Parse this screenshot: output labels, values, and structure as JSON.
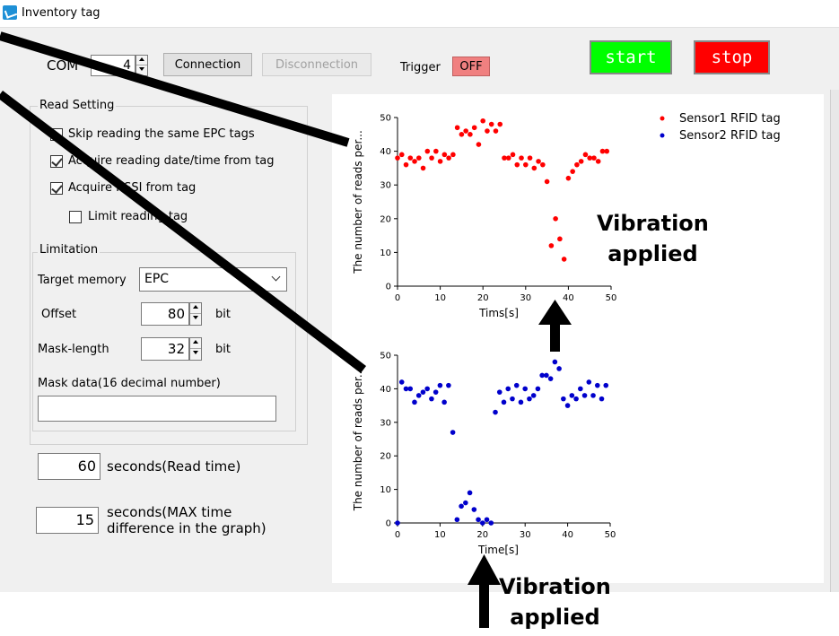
{
  "window": {
    "title": "Inventory tag"
  },
  "toolbar": {
    "com_label": "COM",
    "com_value": "4",
    "connection_label": "Connection",
    "disconnection_label": "Disconnection",
    "trigger_label": "Trigger",
    "trigger_state": "OFF",
    "start_label": "start",
    "stop_label": "stop"
  },
  "read_setting": {
    "title": "Read Setting",
    "skip_same_epc": "Skip reading the same EPC tags",
    "acquire_datetime": "Acquire reading date/time from tag",
    "acquire_rssi": "Acquire RSSI from tag",
    "limit_tag": "Limit reading tag",
    "checks": {
      "skip_same_epc": false,
      "acquire_datetime": true,
      "acquire_rssi": true,
      "limit_tag": false
    }
  },
  "limitation": {
    "title": "Limitation",
    "target_memory_label": "Target memory",
    "target_memory_value": "EPC",
    "offset_label": "Offset",
    "offset_value": "80",
    "offset_unit": "bit",
    "mask_length_label": "Mask-length",
    "mask_length_value": "32",
    "mask_length_unit": "bit",
    "mask_data_label": "Mask data(16 decimal number)",
    "mask_data_value": ""
  },
  "timing": {
    "read_time_value": "60",
    "read_time_label": "seconds(Read time)",
    "max_diff_value": "15",
    "max_diff_label_1": "seconds(MAX time",
    "max_diff_label_2": "difference in the graph)"
  },
  "annotations": {
    "top": [
      "Vibration",
      "applied"
    ],
    "bottom": [
      "Vibration",
      "applied"
    ]
  },
  "colors": {
    "sensor1": "#ff0000",
    "sensor2": "#0000cc",
    "start": "#00ff00",
    "stop": "#ff0000",
    "trigger_off": "#f08080"
  },
  "chart_data": [
    {
      "type": "scatter",
      "ylabel": "The number of reads per...",
      "xlabel": "Tims[s]",
      "xlim": [
        0,
        50
      ],
      "ylim": [
        0,
        50
      ],
      "xticks": [
        0,
        10,
        20,
        30,
        40,
        50
      ],
      "yticks": [
        0,
        10,
        20,
        30,
        40,
        50
      ],
      "legend": "top-right",
      "series": [
        {
          "name": "Sensor1 RFID tag",
          "color": "#ff0000",
          "points": [
            [
              0,
              38
            ],
            [
              1,
              39
            ],
            [
              2,
              36
            ],
            [
              3,
              38
            ],
            [
              4,
              37
            ],
            [
              5,
              38
            ],
            [
              6,
              35
            ],
            [
              7,
              40
            ],
            [
              8,
              38
            ],
            [
              9,
              40
            ],
            [
              10,
              37
            ],
            [
              11,
              39
            ],
            [
              12,
              38
            ],
            [
              13,
              39
            ],
            [
              14,
              47
            ],
            [
              15,
              45
            ],
            [
              16,
              46
            ],
            [
              17,
              45
            ],
            [
              18,
              47
            ],
            [
              19,
              42
            ],
            [
              20,
              49
            ],
            [
              21,
              46
            ],
            [
              22,
              48
            ],
            [
              23,
              46
            ],
            [
              24,
              48
            ],
            [
              25,
              38
            ],
            [
              26,
              38
            ],
            [
              27,
              39
            ],
            [
              28,
              36
            ],
            [
              29,
              38
            ],
            [
              30,
              36
            ],
            [
              31,
              38
            ],
            [
              32,
              35
            ],
            [
              33,
              37
            ],
            [
              34,
              36
            ],
            [
              35,
              31
            ],
            [
              36,
              12
            ],
            [
              37,
              20
            ],
            [
              38,
              14
            ],
            [
              39,
              8
            ],
            [
              40,
              32
            ],
            [
              41,
              34
            ],
            [
              42,
              36
            ],
            [
              43,
              37
            ],
            [
              44,
              39
            ],
            [
              45,
              38
            ],
            [
              46,
              38
            ],
            [
              47,
              37
            ],
            [
              48,
              40
            ],
            [
              49,
              40
            ]
          ]
        },
        {
          "name": "Sensor2 RFID tag",
          "color": "#0000cc",
          "points": []
        }
      ]
    },
    {
      "type": "scatter",
      "ylabel": "The number of reads per...",
      "xlabel": "Time[s]",
      "xlim": [
        0,
        50
      ],
      "ylim": [
        0,
        50
      ],
      "xticks": [
        0,
        10,
        20,
        30,
        40,
        50
      ],
      "yticks": [
        0,
        10,
        20,
        30,
        40,
        50
      ],
      "series": [
        {
          "name": "Sensor2 RFID tag",
          "color": "#0000cc",
          "points": [
            [
              0,
              0
            ],
            [
              1,
              42
            ],
            [
              2,
              40
            ],
            [
              3,
              40
            ],
            [
              4,
              36
            ],
            [
              5,
              38
            ],
            [
              6,
              39
            ],
            [
              7,
              40
            ],
            [
              8,
              37
            ],
            [
              9,
              39
            ],
            [
              10,
              41
            ],
            [
              11,
              36
            ],
            [
              12,
              41
            ],
            [
              13,
              27
            ],
            [
              14,
              1
            ],
            [
              15,
              5
            ],
            [
              16,
              6
            ],
            [
              17,
              9
            ],
            [
              18,
              4
            ],
            [
              19,
              1
            ],
            [
              20,
              0
            ],
            [
              21,
              1
            ],
            [
              22,
              0
            ],
            [
              23,
              33
            ],
            [
              24,
              39
            ],
            [
              25,
              36
            ],
            [
              26,
              40
            ],
            [
              27,
              37
            ],
            [
              28,
              41
            ],
            [
              29,
              36
            ],
            [
              30,
              40
            ],
            [
              31,
              37
            ],
            [
              32,
              38
            ],
            [
              33,
              40
            ],
            [
              34,
              44
            ],
            [
              35,
              44
            ],
            [
              36,
              43
            ],
            [
              37,
              48
            ],
            [
              38,
              46
            ],
            [
              39,
              37
            ],
            [
              40,
              35
            ],
            [
              41,
              38
            ],
            [
              42,
              37
            ],
            [
              43,
              40
            ],
            [
              44,
              38
            ],
            [
              45,
              42
            ],
            [
              46,
              38
            ],
            [
              47,
              41
            ],
            [
              48,
              37
            ],
            [
              49,
              41
            ]
          ]
        }
      ]
    }
  ]
}
